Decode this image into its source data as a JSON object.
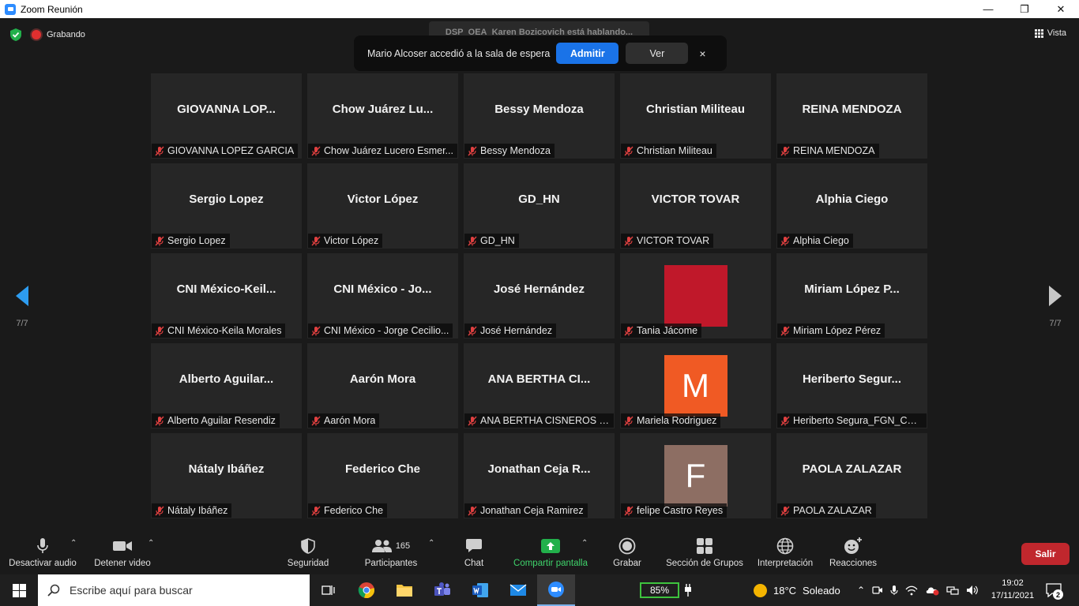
{
  "window": {
    "title": "Zoom Reunión",
    "minimize": "—",
    "maximize": "❐",
    "close": "✕"
  },
  "recording": {
    "label": "Grabando"
  },
  "view": {
    "label": "Vista"
  },
  "speaking_banner": "DSP_OEA_Karen Bozicovich está hablando...",
  "waiting_notification": {
    "text": "Mario Alcoser accedió a la sala de espera",
    "admit_label": "Admitir",
    "see_label": "Ver",
    "close_label": "×"
  },
  "page_indicator": {
    "left": "7/7",
    "right": "7/7"
  },
  "participants": [
    {
      "display": "GIOVANNA  LOP...",
      "label": "GIOVANNA LOPEZ GARCIA"
    },
    {
      "display": "Chow  Juárez  Lu...",
      "label": "Chow Juárez Lucero Esmer..."
    },
    {
      "display": "Bessy Mendoza",
      "label": "Bessy Mendoza"
    },
    {
      "display": "Christian Militeau",
      "label": "Christian Militeau"
    },
    {
      "display": "REINA MENDOZA",
      "label": "REINA MENDOZA"
    },
    {
      "display": "Sergio Lopez",
      "label": "Sergio Lopez"
    },
    {
      "display": "Victor López",
      "label": "Victor López"
    },
    {
      "display": "GD_HN",
      "label": "GD_HN"
    },
    {
      "display": "VICTOR TOVAR",
      "label": "VICTOR TOVAR"
    },
    {
      "display": "Alphia Ciego",
      "label": "Alphia Ciego"
    },
    {
      "display": "CNI  México-Keil...",
      "label": "CNI México-Keila Morales"
    },
    {
      "display": "CNI  México  -  Jo...",
      "label": "CNI México - Jorge Cecilio..."
    },
    {
      "display": "José Hernández",
      "label": "José Hernández"
    },
    {
      "display": "",
      "label": "Tania Jácome",
      "avatar_color": "#c0182a",
      "avatar_letter": ""
    },
    {
      "display": "Miriam  López  P...",
      "label": "Miriam López Pérez"
    },
    {
      "display": "Alberto  Aguilar...",
      "label": "Alberto Aguilar Resendiz"
    },
    {
      "display": "Aarón Mora",
      "label": "Aarón Mora"
    },
    {
      "display": "ANA BERTHA CI...",
      "label": "ANA BERTHA CISNEROS M..."
    },
    {
      "display": "",
      "label": "Mariela Rodriguez",
      "avatar_color": "#f05a24",
      "avatar_letter": "M"
    },
    {
      "display": "Heriberto  Segur...",
      "label": "Heriberto Segura_FGN_CO..."
    },
    {
      "display": "Nátaly Ibáñez",
      "label": "Nátaly Ibáñez"
    },
    {
      "display": "Federico Che",
      "label": "Federico Che"
    },
    {
      "display": "Jonathan  Ceja  R...",
      "label": "Jonathan Ceja Ramirez"
    },
    {
      "display": "",
      "label": "felipe Castro Reyes",
      "avatar_color": "#8d6e63",
      "avatar_letter": "F"
    },
    {
      "display": "PAOLA ZALAZAR",
      "label": "PAOLA ZALAZAR"
    }
  ],
  "toolbar": {
    "mute": "Desactivar audio",
    "stop_video": "Detener video",
    "security": "Seguridad",
    "participants": "Participantes",
    "participants_count": "165",
    "chat": "Chat",
    "share": "Compartir pantalla",
    "record": "Grabar",
    "breakout": "Sección de Grupos",
    "interpretation": "Interpretación",
    "reactions": "Reacciones",
    "leave": "Salir"
  },
  "taskbar": {
    "search_placeholder": "Escribe aquí para buscar",
    "battery": "85%",
    "temperature": "18°C",
    "weather": "Soleado",
    "time": "19:02",
    "date": "17/11/2021",
    "notifications": "2"
  },
  "colors": {
    "accent": "#1a73e8",
    "share_green": "#22b04b",
    "leave_red": "#c0272d"
  }
}
